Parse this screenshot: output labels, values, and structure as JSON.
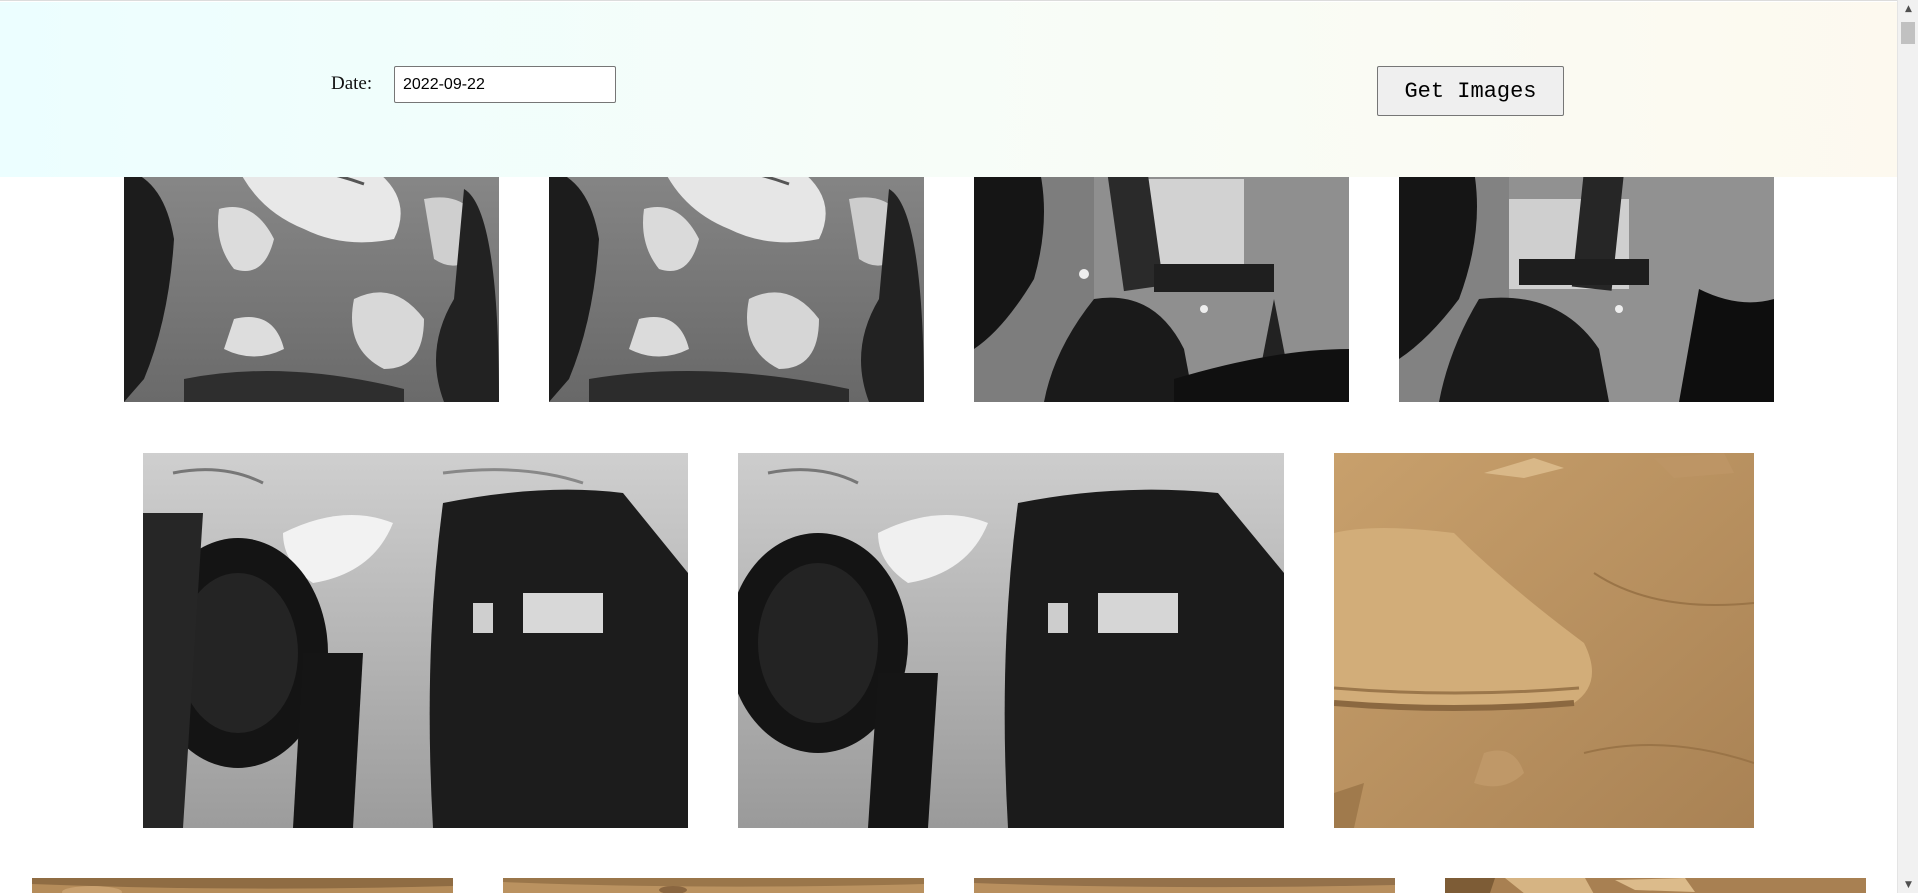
{
  "form": {
    "date_label": "Date:",
    "date_value": "2022-09-22",
    "submit_label": "Get Images"
  },
  "gallery": {
    "photos": [
      {
        "kind": "navcam-rocks-a"
      },
      {
        "kind": "navcam-rocks-a"
      },
      {
        "kind": "navcam-arm-shadow"
      },
      {
        "kind": "navcam-arm-shadow"
      },
      {
        "kind": "hazcam-wheel-shadow"
      },
      {
        "kind": "hazcam-wheel-shadow"
      },
      {
        "kind": "mastcam-color-rock"
      },
      {
        "kind": "mastcam-color-terrain"
      },
      {
        "kind": "mastcam-color-terrain"
      },
      {
        "kind": "mastcam-color-terrain"
      },
      {
        "kind": "mastcam-color-terrain"
      }
    ]
  },
  "colors": {
    "header_gradient_left": "#ecfeff",
    "header_gradient_right": "#fdf9ef",
    "mars_sand": "#b58c5a"
  },
  "scrollbar": {
    "up_icon": "scroll-up-arrow-icon",
    "down_icon": "scroll-down-arrow-icon"
  }
}
